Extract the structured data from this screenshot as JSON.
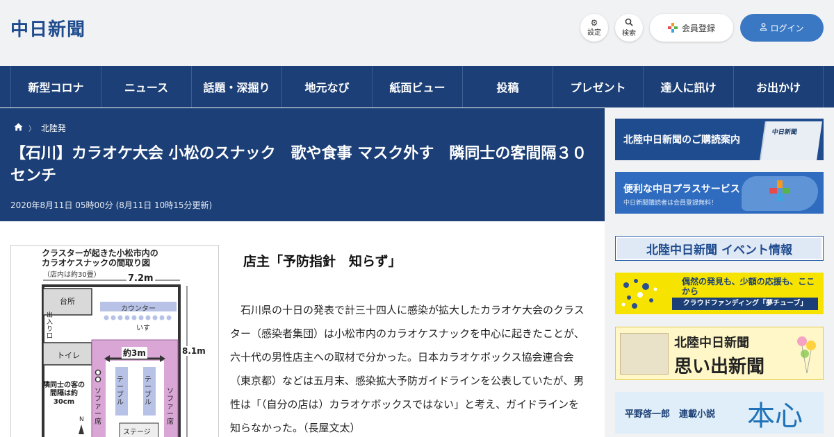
{
  "header": {
    "logo": "中日新聞",
    "settings_label": "設定",
    "search_label": "検索",
    "register_label": "会員登録",
    "login_label": "ログイン"
  },
  "nav": {
    "items": [
      "新型コロナ",
      "ニュース",
      "話題・深掘り",
      "地元なび",
      "紙面ビュー",
      "投稿",
      "プレゼント",
      "達人に訊け",
      "お出かけ"
    ]
  },
  "breadcrumb": {
    "current": "北陸発"
  },
  "article": {
    "title": "【石川】カラオケ大会 小松のスナック　歌や食事 マスク外す　隣同士の客間隔３０センチ",
    "date": "2020年8月11日 05時00分 (8月11日 10時15分更新)",
    "subhead": "店主「予防指針　知らず」",
    "body": "石川県の十日の発表で計三十四人に感染が拡大したカラオケ大会のクラスター（感染者集団）は小松市内のカラオケスナックを中心に起きたことが、六十代の男性店主への取材で分かった。日本カラオケボックス協会連合会（東京都）などは五月末、感染拡大予防ガイドラインを公表していたが、男性は「（自分の店は）カラオケボックスではない」と考え、ガイドラインを知らなかった。（長屋文太）"
  },
  "figure": {
    "title_line1": "クラスターが起きた小松市内の",
    "title_line2": "カラオケスナックの間取り図",
    "note": "（店内は約30畳）",
    "width_label": "7.2m",
    "depth_label": "8.1m",
    "kitchen": "台所",
    "counter": "カウンター",
    "chairs": "いす",
    "entrance": "出入り口",
    "toilet": "トイレ",
    "span_label": "約3m",
    "table": "テーブル",
    "sofa": "ソファー席",
    "spacing_note": "隣同士の客の間隔は約30cm",
    "north": "N",
    "stage": "ステージ"
  },
  "sidebar": {
    "banner1": "北陸中日新聞のご購読案内",
    "banner1_paper": "中日新聞",
    "banner2_title": "便利な中日プラスサービス",
    "banner2_sub": "中日新聞購読者は会員登録無料！",
    "banner3": "北陸中日新聞 イベント情報",
    "banner4_title": "偶然の発見も、少額の応援も、ここから",
    "banner4_sub": "クラウドファンディング「夢チューブ」",
    "banner5_title": "北陸中日新聞",
    "banner5_sub": "思い出新聞",
    "banner6_author": "平野啓一郎　連載小説",
    "banner6_title": "本心"
  },
  "colors": {
    "navy": "#1b3f76",
    "accent_blue": "#3a78c4",
    "sofa_pink": "#d9a6d6"
  }
}
